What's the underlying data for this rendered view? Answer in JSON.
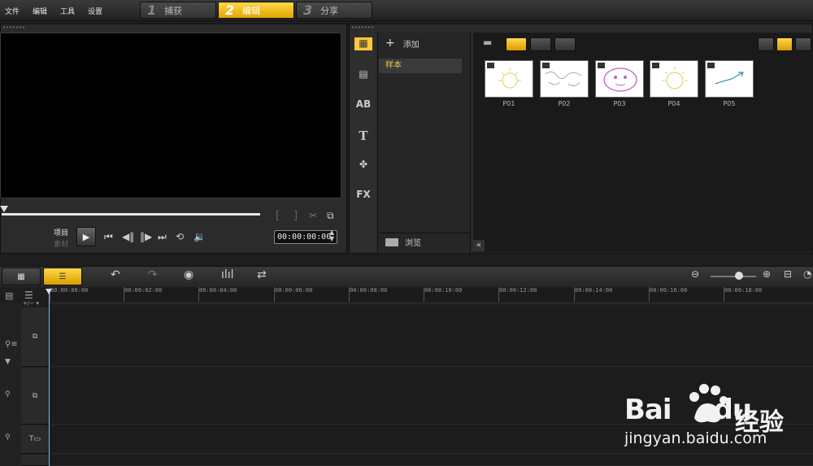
{
  "menu": [
    "文件",
    "编辑",
    "工具",
    "设置"
  ],
  "steps": [
    {
      "num": "1",
      "label": "捕获",
      "active": false
    },
    {
      "num": "2",
      "label": "编辑",
      "active": true
    },
    {
      "num": "3",
      "label": "分享",
      "active": false
    }
  ],
  "player": {
    "mode_project": "项目",
    "mode_clip": "素材",
    "timecode": "00:00:00:00",
    "bracket_in": "[",
    "bracket_out": "]"
  },
  "library": {
    "side_icons": [
      "media-icon",
      "transition-icon",
      "title-ab-icon",
      "text-t-icon",
      "graphic-icon",
      "fx-icon"
    ],
    "fx_label": "FX",
    "ab_label": "AB",
    "t_label": "T",
    "add_label": "添加",
    "folder": "样本",
    "browse_label": "浏览",
    "thumbs": [
      "P01",
      "P02",
      "P03",
      "P04",
      "P05"
    ]
  },
  "timeline": {
    "ticks": [
      "00:00:00:00",
      "00:00:02:00",
      "00:00:04:00",
      "00:00:06:00",
      "00:00:08:00",
      "00:00:10:00",
      "00:00:12:00",
      "00:00:14:00",
      "00:00:16:00",
      "00:00:18:00"
    ]
  },
  "watermark": {
    "brand": "Bai",
    "brand2": "du",
    "cn": "经验",
    "url": "jingyan.baidu.com"
  },
  "colors": {
    "accent": "#f5c518",
    "folder_text": "#e8c94a"
  }
}
